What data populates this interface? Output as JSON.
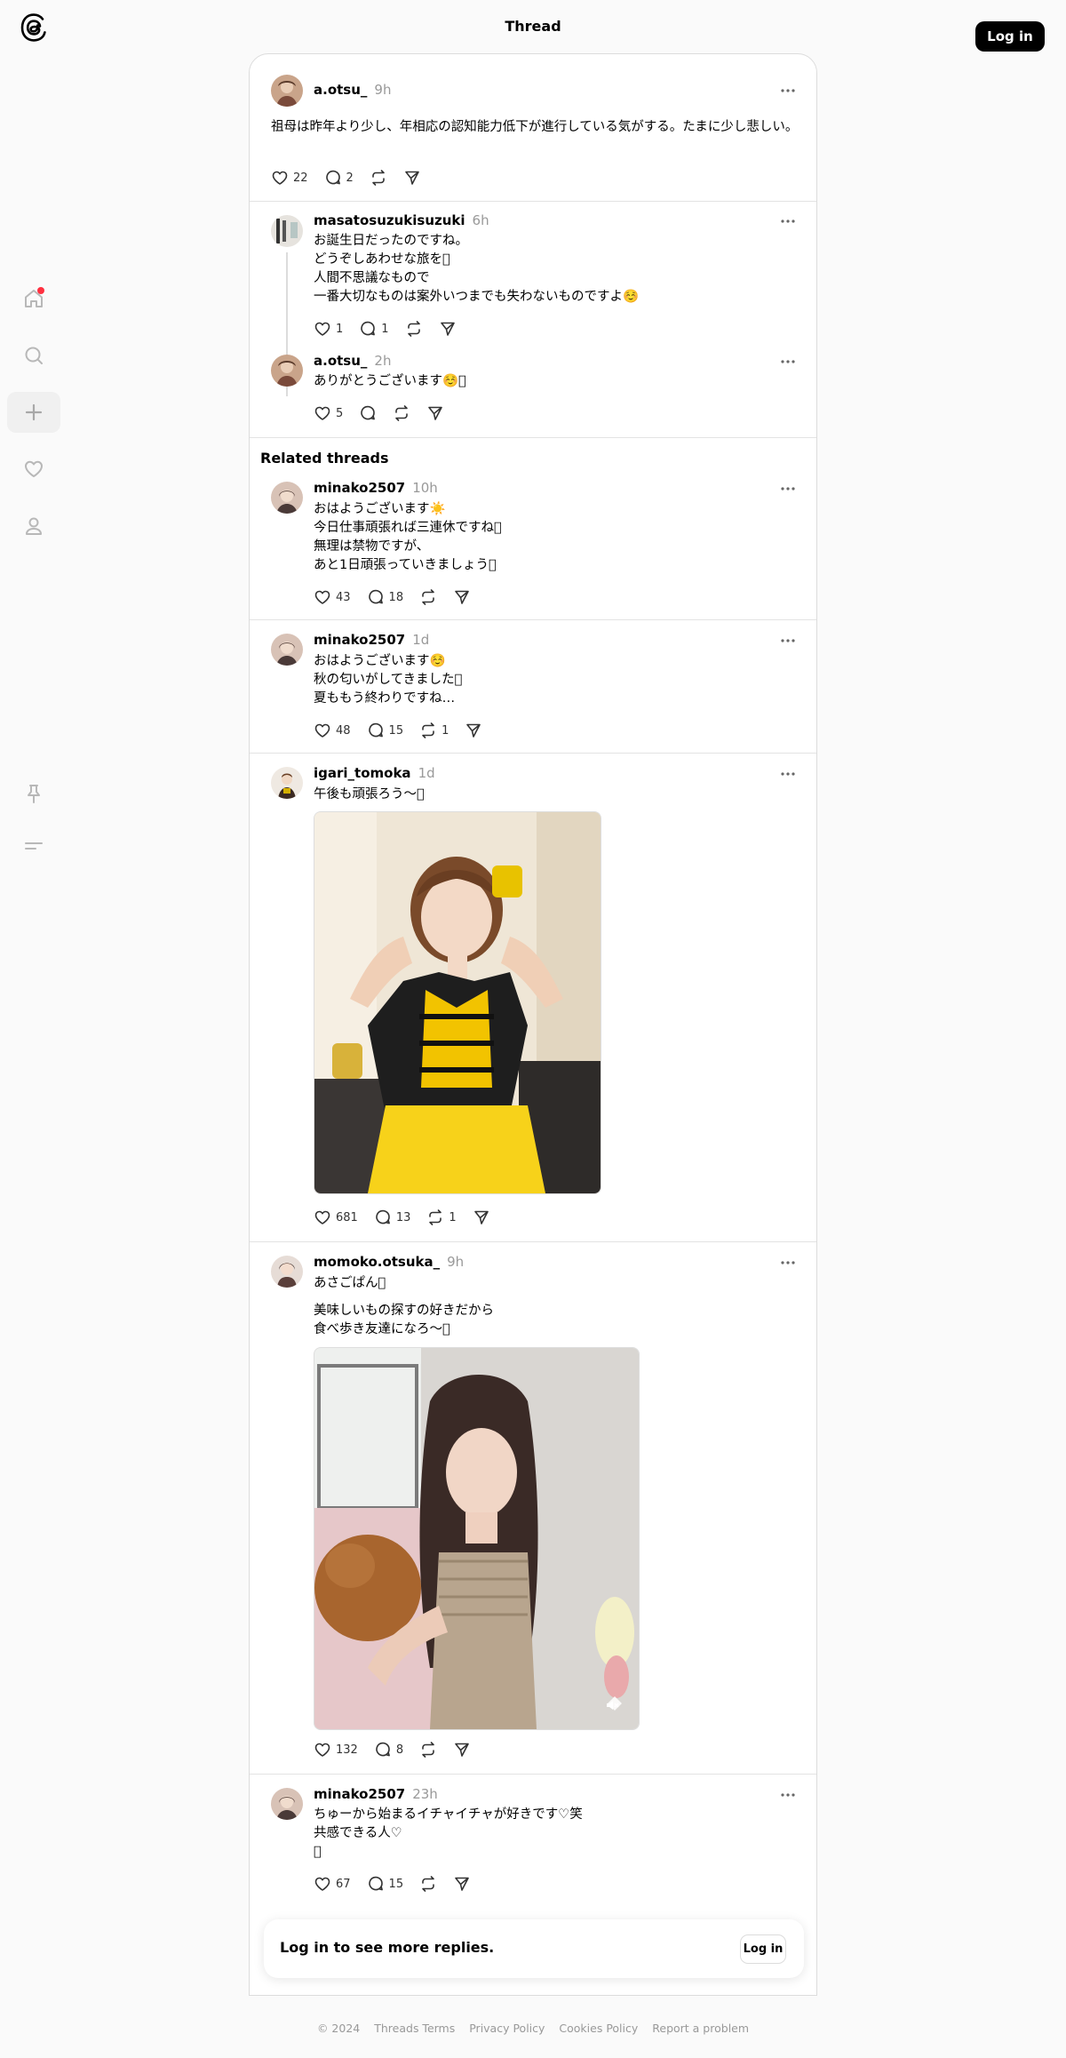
{
  "header": {
    "title": "Thread",
    "login_label": "Log in"
  },
  "nav": [
    "home-icon",
    "search-icon",
    "create-icon",
    "activity-icon",
    "profile-icon",
    "pin-icon",
    "menu-icon"
  ],
  "main_post": {
    "username": "a.otsu_",
    "time": "9h",
    "text": "祖母は昨年より少し、年相応の認知能力低下が進行している気がする。たまに少し悲しい。",
    "likes": "22",
    "replies": "2"
  },
  "reply1": {
    "username": "masatosuzukisuzuki",
    "time": "6h",
    "lines": [
      "お誕生日だったのですね。",
      "どうぞしあわせな旅を􏿾",
      "人間不思議なもので",
      "一番大切なものは案外いつまでも失わないものですよ☺️"
    ],
    "likes": "1",
    "replies": "1"
  },
  "reply2": {
    "username": "a.otsu_",
    "time": "2h",
    "lines": [
      "ありがとうございます☺️􏿾"
    ],
    "likes": "5"
  },
  "related_title": "Related threads",
  "rel1": {
    "username": "minako2507",
    "time": "10h",
    "lines": [
      "おはようございます☀️",
      "今日仕事頑張れば三連休ですね􏿾",
      "無理は禁物ですが、",
      "あと1日頑張っていきましょう􏿾"
    ],
    "likes": "43",
    "replies": "18"
  },
  "rel2": {
    "username": "minako2507",
    "time": "1d",
    "lines": [
      "おはようございます☺️",
      "秋の匂いがしてきました􏿾",
      "夏ももう終わりですね…"
    ],
    "likes": "48",
    "replies": "15",
    "reposts": "1"
  },
  "rel3": {
    "username": "igari_tomoka",
    "time": "1d",
    "lines": [
      "午後も頑張ろう〜􏿾"
    ],
    "likes": "681",
    "replies": "13",
    "reposts": "1"
  },
  "rel4": {
    "username": "momoko.otsuka_",
    "time": "9h",
    "lines": [
      "あさごぱん􏿾"
    ],
    "lines2": [
      "美味しいもの探すの好きだから",
      "食べ歩き友達になろ〜􏿾"
    ],
    "likes": "132",
    "replies": "8"
  },
  "rel5": {
    "username": "minako2507",
    "time": "23h",
    "lines": [
      "ちゅーから始まるイチャイチャが好きです♡笑",
      "共感できる人♡",
      "􏿾"
    ],
    "likes": "67",
    "replies": "15"
  },
  "more_replies": {
    "text": "Log in to see more replies.",
    "button": "Log in"
  },
  "footer": [
    "© 2024",
    "Threads Terms",
    "Privacy Policy",
    "Cookies Policy",
    "Report a problem"
  ],
  "colors": {
    "accent_dot": "#ff3040",
    "button_bg": "#000000"
  }
}
